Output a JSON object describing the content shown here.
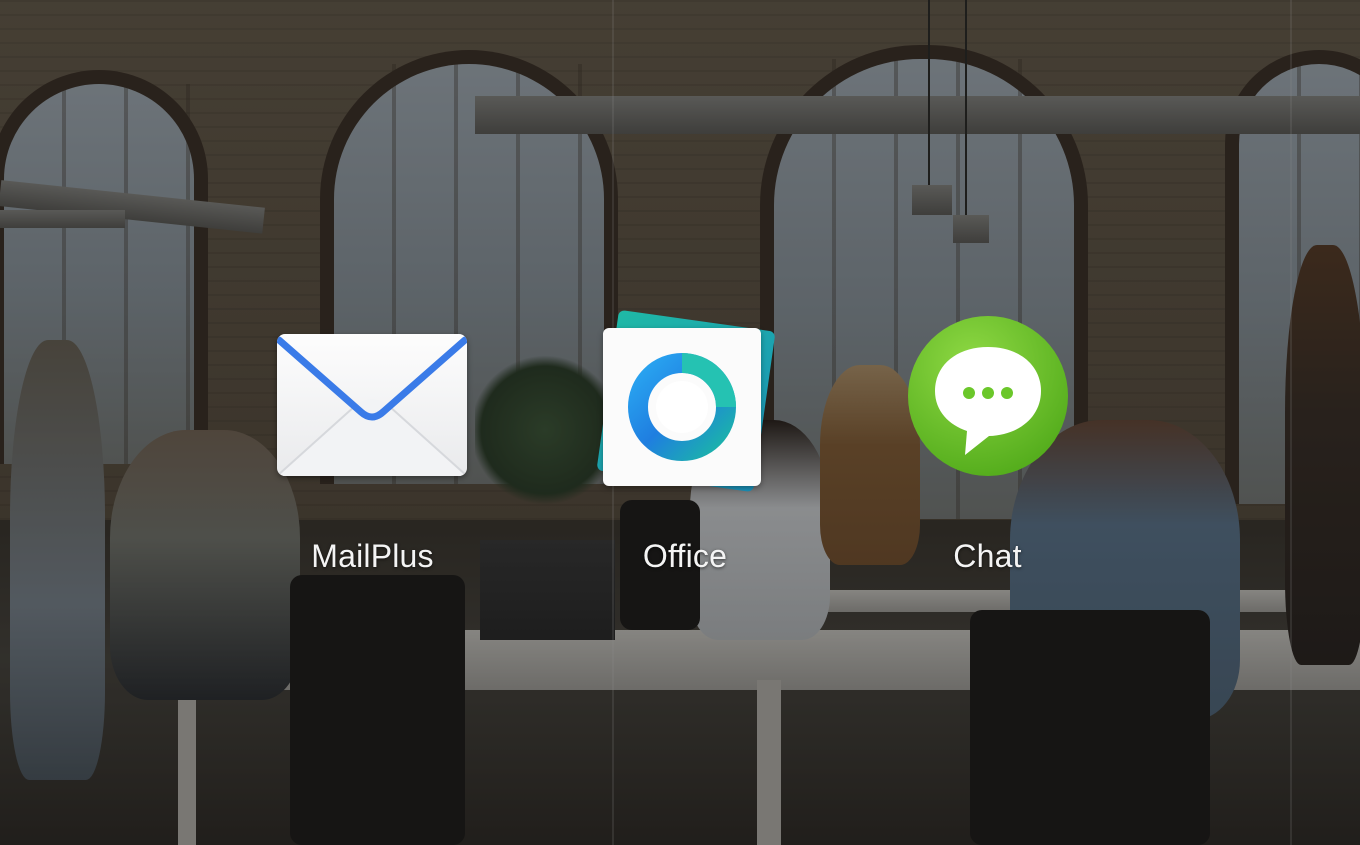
{
  "apps": [
    {
      "label": "MailPlus",
      "icon": "envelope-icon"
    },
    {
      "label": "Office",
      "icon": "office-ring-icon"
    },
    {
      "label": "Chat",
      "icon": "chat-bubble-icon"
    }
  ],
  "colors": {
    "mail_accent": "#3a7be8",
    "office_teal": "#1fb9a6",
    "office_blue": "#2f7fe0",
    "chat_green": "#6bc72a"
  }
}
